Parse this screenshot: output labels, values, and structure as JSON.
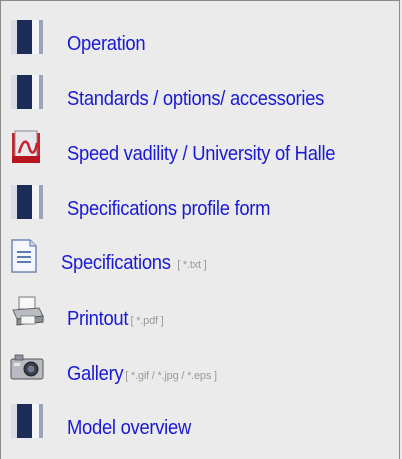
{
  "links": [
    {
      "icon": "doc-icon",
      "label": "Operation",
      "hint": ""
    },
    {
      "icon": "doc-icon",
      "label": "Standards / options/ accessories",
      "hint": ""
    },
    {
      "icon": "pdf-icon",
      "label": "Speed vadility / University of Halle",
      "hint": ""
    },
    {
      "icon": "doc-icon",
      "label": "Specifications profile form",
      "hint": ""
    },
    {
      "icon": "text-file-icon",
      "label": "Specifications",
      "hint": "[ *.txt ]"
    },
    {
      "icon": "printer-icon",
      "label": "Printout",
      "hint": "[ *.pdf ]"
    },
    {
      "icon": "camera-icon",
      "label": "Gallery",
      "hint": "[ *.gif / *.jpg / *.eps ]"
    },
    {
      "icon": "doc-icon",
      "label": "Model overview",
      "hint": ""
    }
  ]
}
